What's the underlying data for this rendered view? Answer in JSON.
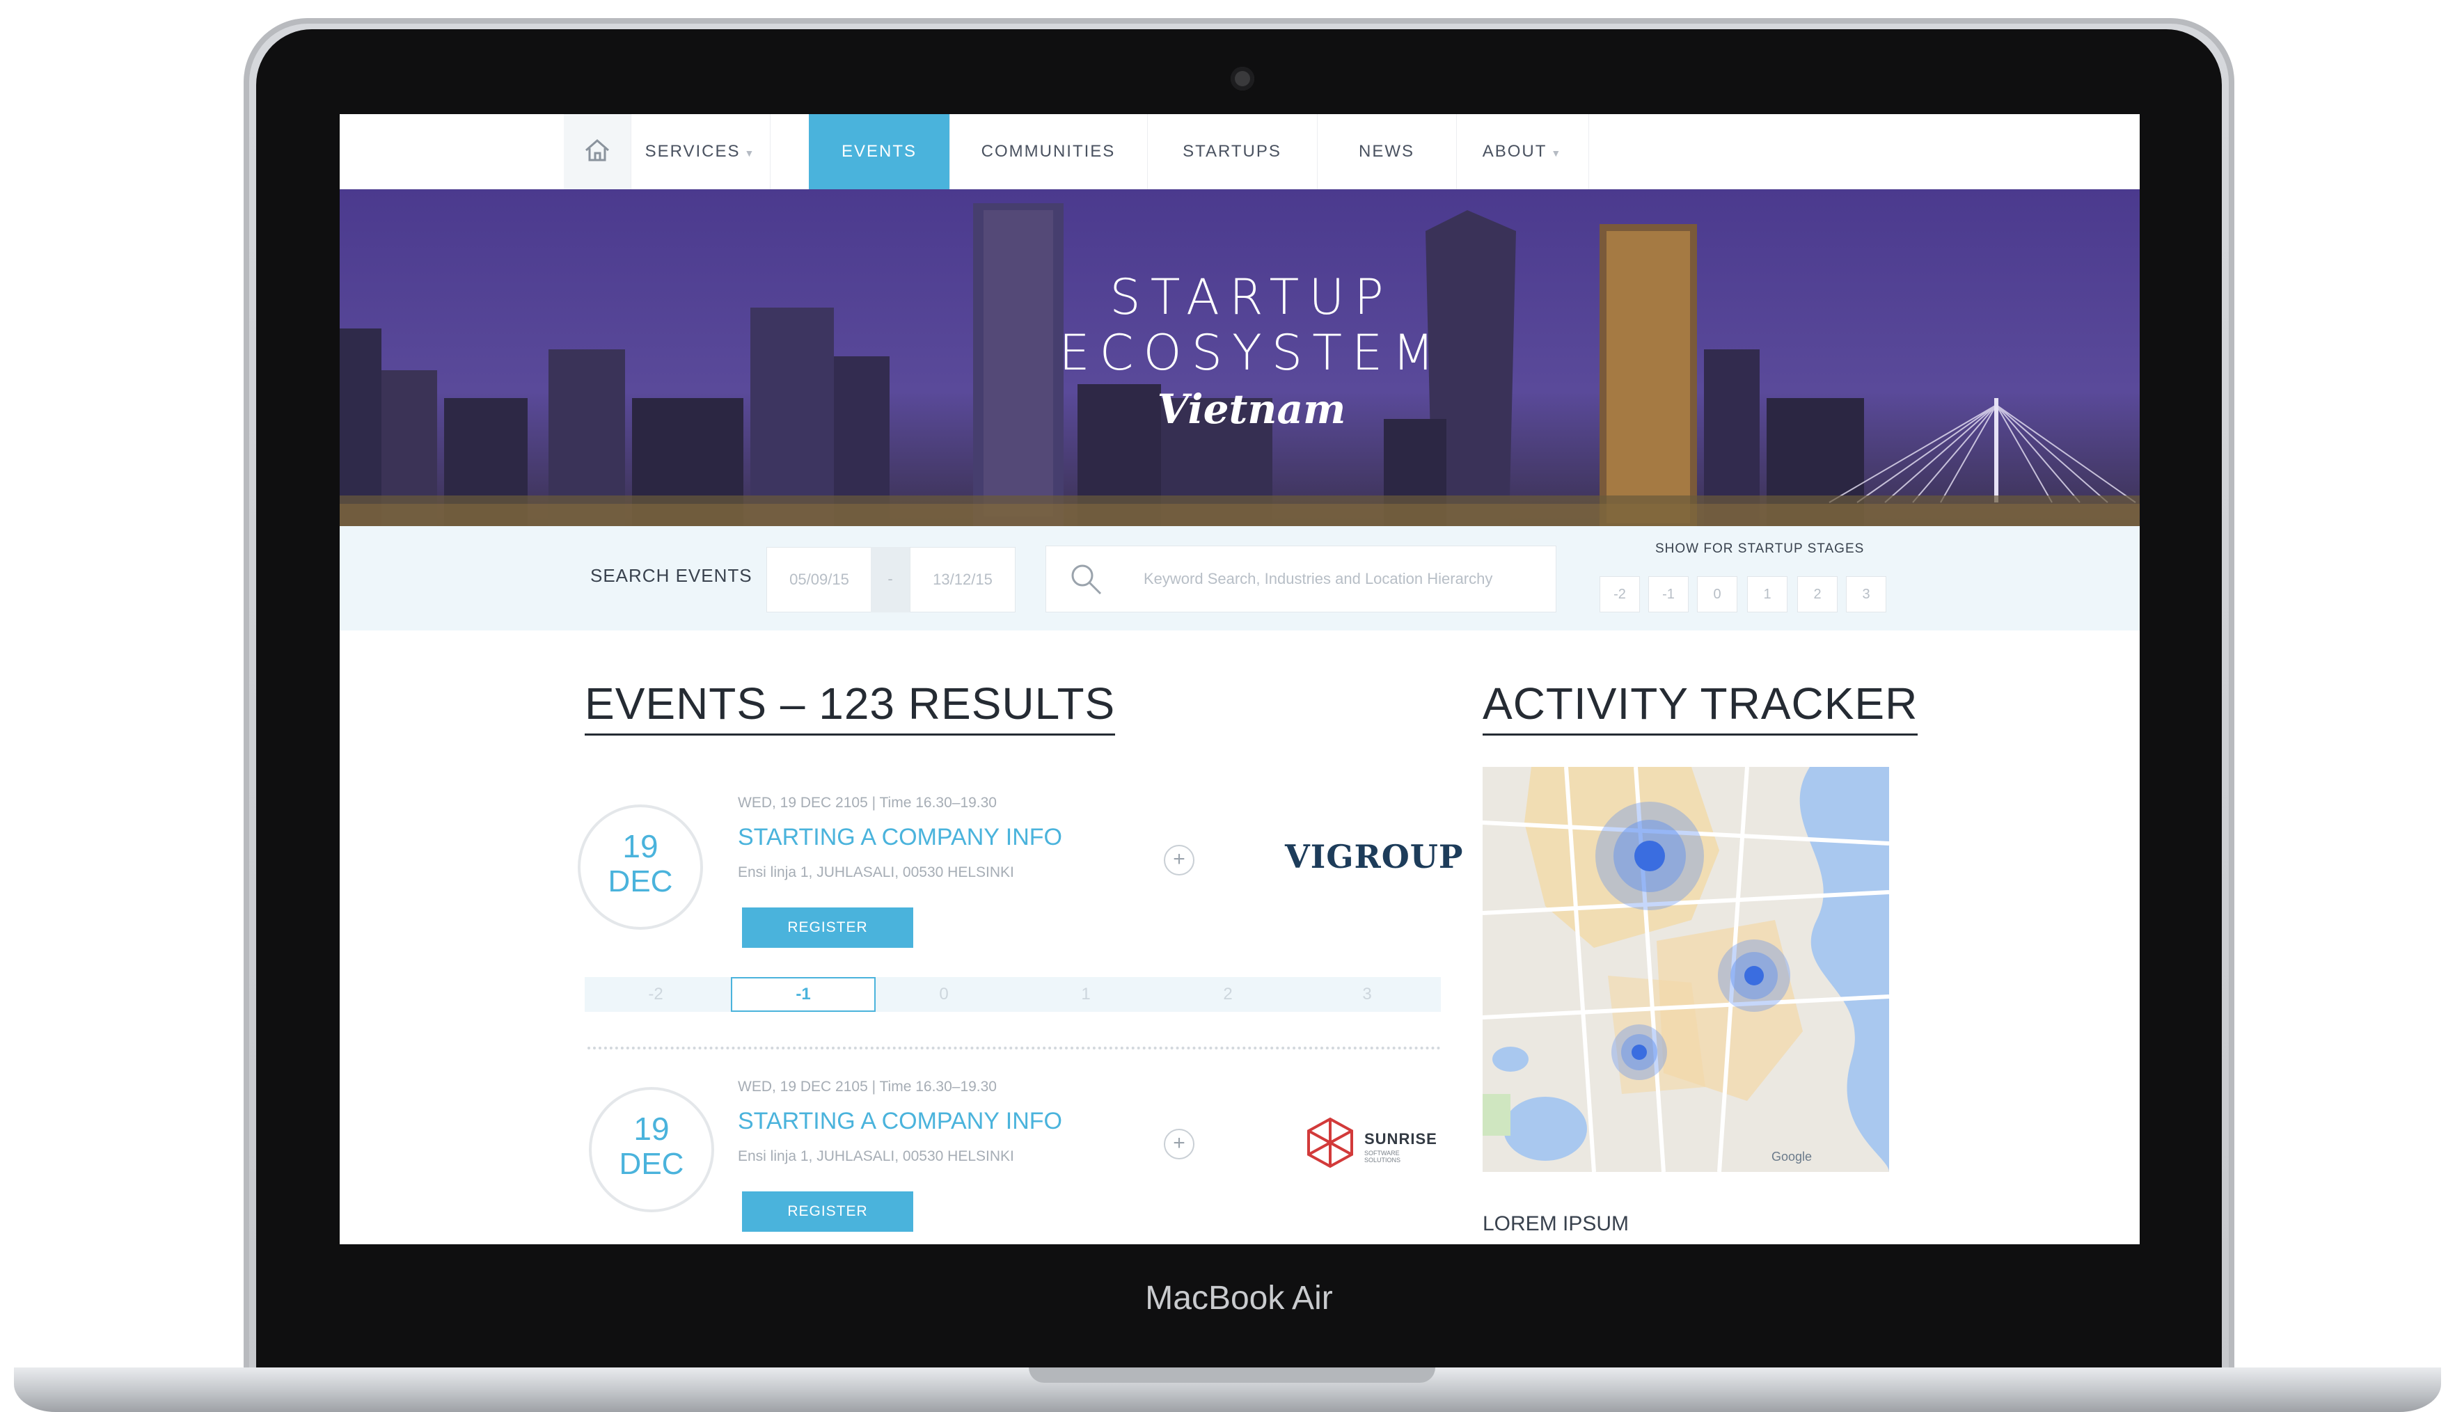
{
  "device": {
    "brand_label": "MacBook Air"
  },
  "nav": {
    "items": [
      {
        "label": "SERVICES",
        "has_caret": true
      },
      {
        "label": "EVENTS",
        "active": true
      },
      {
        "label": "COMMUNITIES"
      },
      {
        "label": "STARTUPS"
      },
      {
        "label": "NEWS"
      },
      {
        "label": "ABOUT",
        "has_caret": true
      }
    ],
    "home_icon": "home-icon",
    "accent_color": "#4ab3dc"
  },
  "hero": {
    "line1": "STARTUP",
    "line2": "ECOSYSTEM",
    "subtitle": "Vietnam"
  },
  "search": {
    "label": "SEARCH EVENTS",
    "date_from": "05/09/15",
    "date_sep": "-",
    "date_to": "13/12/15",
    "keyword_placeholder": "Keyword Search, Industries and Location Hierarchy",
    "stages_label": "SHOW FOR STARTUP STAGES",
    "stages": [
      "-2",
      "-1",
      "0",
      "1",
      "2",
      "3"
    ]
  },
  "events": {
    "heading": "EVENTS – 123 RESULTS",
    "items": [
      {
        "day": "19",
        "month": "DEC",
        "meta": "WED, 19 DEC 2105 | Time 16.30–19.30",
        "title": "STARTING A COMPANY INFO",
        "address": "Ensi linja 1, JUHLASALI, 00530 HELSINKI",
        "register": "REGISTER",
        "plus": "+",
        "logo_text": "VIGROUP"
      },
      {
        "day": "19",
        "month": "DEC",
        "meta": "WED, 19 DEC 2105 | Time 16.30–19.30",
        "title": "STARTING A COMPANY INFO",
        "address": "Ensi linja 1, JUHLASALI, 00530 HELSINKI",
        "register": "REGISTER",
        "plus": "+",
        "logo_text": "SUNRISE",
        "logo_sub": "SOFTWARE SOLUTIONS"
      }
    ],
    "stage_bar": [
      "-2",
      "-1",
      "0",
      "1",
      "2",
      "3"
    ],
    "stage_selected": "-1"
  },
  "tracker": {
    "heading": "ACTIVITY TRACKER",
    "footer_label": "LOREM IPSUM",
    "map_attribution": "Google"
  }
}
